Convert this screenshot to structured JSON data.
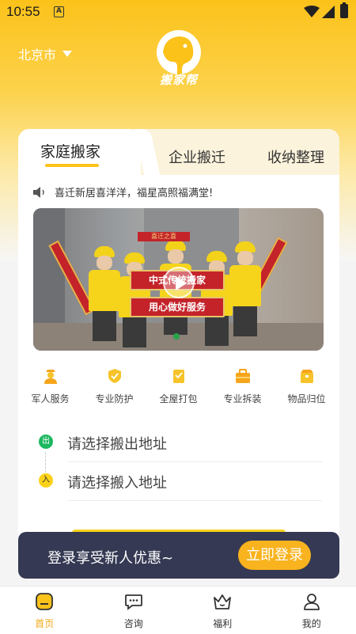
{
  "statusbar": {
    "time": "10:55",
    "notification_icon": "A"
  },
  "header": {
    "city": "北京市",
    "logo_text": "搬家帮"
  },
  "tabs": [
    {
      "label": "家庭搬家",
      "active": true
    },
    {
      "label": "企业搬迁",
      "active": false
    },
    {
      "label": "收纳整理",
      "active": false
    }
  ],
  "notice": {
    "text": "喜迁新居喜洋洋，福星高照福满堂!"
  },
  "banner": {
    "top_caption": "喜迁之喜",
    "sign_line1": "中式传统搬家",
    "sign_line2": "用心做好服务"
  },
  "services": [
    {
      "label": "军人服务",
      "icon": "soldier-icon"
    },
    {
      "label": "专业防护",
      "icon": "shield-icon"
    },
    {
      "label": "全屋打包",
      "icon": "package-icon"
    },
    {
      "label": "专业拆装",
      "icon": "toolbox-icon"
    },
    {
      "label": "物品归位",
      "icon": "box-icon"
    }
  ],
  "address": {
    "out_badge": "出",
    "out_placeholder": "请选择搬出地址",
    "in_badge": "入",
    "in_placeholder": "请选择搬入地址"
  },
  "login": {
    "text": "登录享受新人优惠~",
    "button": "立即登录"
  },
  "bottom_nav": [
    {
      "label": "首页",
      "icon": "home-icon",
      "active": true
    },
    {
      "label": "咨询",
      "icon": "chat-icon",
      "active": false
    },
    {
      "label": "福利",
      "icon": "crown-icon",
      "active": false
    },
    {
      "label": "我的",
      "icon": "user-icon",
      "active": false
    }
  ],
  "colors": {
    "brand": "#fbc21a",
    "accent_orange": "#f9b31e",
    "login_bar": "#353953",
    "active_nav": "#f3a917"
  }
}
